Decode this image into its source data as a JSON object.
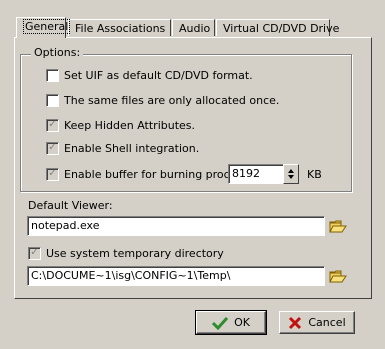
{
  "tabs": [
    {
      "label": "General",
      "active": true
    },
    {
      "label": "File Associations",
      "active": false
    },
    {
      "label": "Audio",
      "active": false
    },
    {
      "label": "Virtual CD/DVD Drive",
      "active": false
    }
  ],
  "options": {
    "group_label": "Options:",
    "items": [
      {
        "label": "Set UIF as default CD/DVD format.",
        "checked": false
      },
      {
        "label": "The same files are only allocated once.",
        "checked": false
      },
      {
        "label": "Keep Hidden Attributes.",
        "checked": true
      },
      {
        "label": "Enable Shell integration.",
        "checked": true
      },
      {
        "label": "Enable buffer for burning process",
        "checked": true
      }
    ],
    "buffer_value": "8192",
    "buffer_unit": "KB"
  },
  "default_viewer": {
    "label": "Default Viewer:",
    "value": "notepad.exe"
  },
  "temp": {
    "label": "Use system temporary directory",
    "checked": true,
    "path": "C:\\DOCUME~1\\isg\\CONFIG~1\\Temp\\"
  },
  "buttons": {
    "ok": "OK",
    "cancel": "Cancel"
  },
  "colors": {
    "face": "#d4d0c8",
    "ok_check": "#2e8b2e",
    "cancel_x": "#c01010"
  }
}
